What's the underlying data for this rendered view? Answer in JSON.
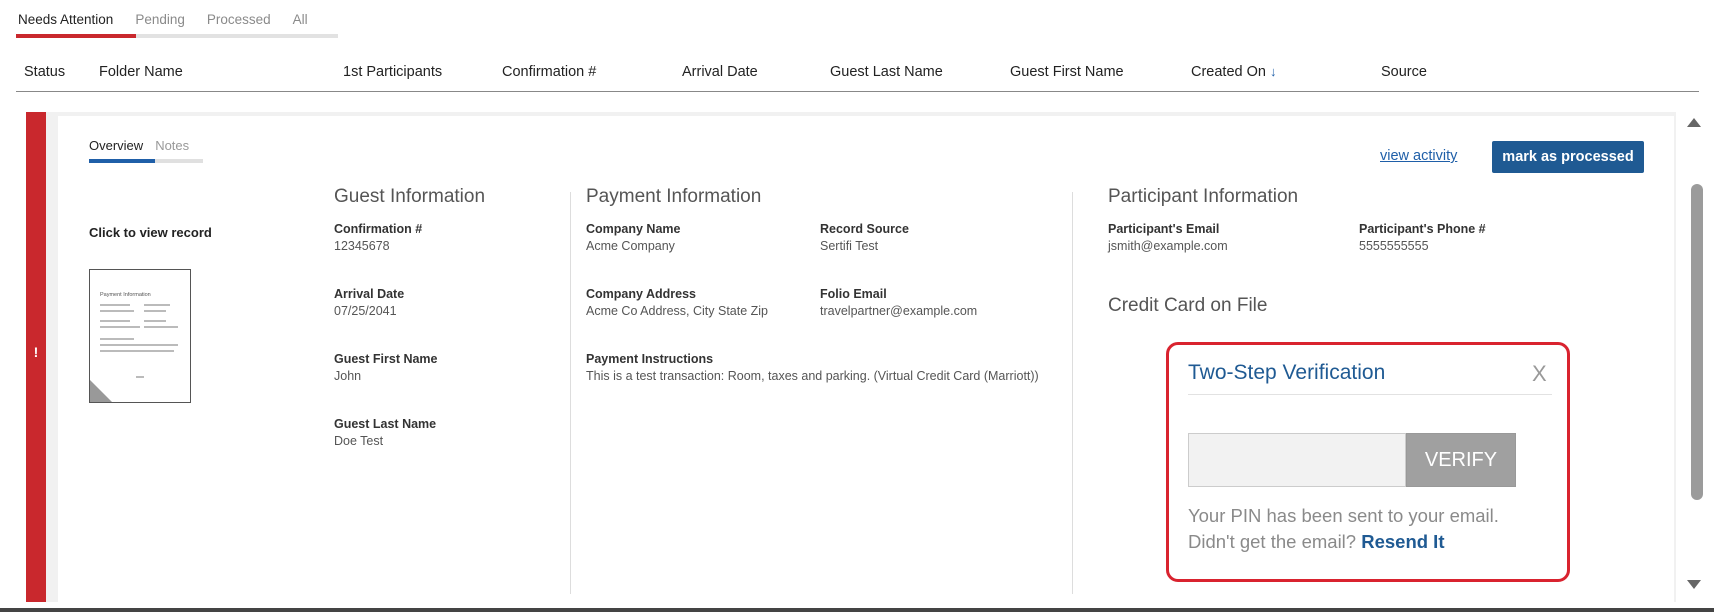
{
  "status_tabs": [
    {
      "label": "Needs Attention"
    },
    {
      "label": "Pending"
    },
    {
      "label": "Processed"
    },
    {
      "label": "All"
    }
  ],
  "columns": {
    "status": "Status",
    "folder_name": "Folder Name",
    "participants": "1st Participants",
    "confirmation": "Confirmation #",
    "arrival_date": "Arrival Date",
    "guest_last_name": "Guest Last Name",
    "guest_first_name": "Guest First Name",
    "created_on": "Created On",
    "source": "Source"
  },
  "row": {
    "status_flag": "!",
    "inner_tabs": [
      {
        "label": "Overview"
      },
      {
        "label": "Notes"
      }
    ],
    "view_activity": "view activity",
    "mark_processed": "mark as processed",
    "record_link": "Click to view record",
    "thumbnail_title": "Payment Information",
    "guest": {
      "title": "Guest Information",
      "confirmation_label": "Confirmation #",
      "confirmation_value": "12345678",
      "arrival_label": "Arrival Date",
      "arrival_value": "07/25/2041",
      "first_label": "Guest First Name",
      "first_value": "John",
      "last_label": "Guest Last Name",
      "last_value": "Doe Test"
    },
    "payment": {
      "title": "Payment Information",
      "company_name_label": "Company Name",
      "company_name_value": "Acme Company",
      "record_source_label": "Record Source",
      "record_source_value": "Sertifi Test",
      "company_address_label": "Company Address",
      "company_address_value": "Acme Co Address, City State Zip",
      "folio_email_label": "Folio Email",
      "folio_email_value": "travelpartner@example.com",
      "instructions_label": "Payment Instructions",
      "instructions_value": "This is a test transaction: Room, taxes and parking. (Virtual Credit Card (Marriott))"
    },
    "participant": {
      "title": "Participant Information",
      "email_label": "Participant's Email",
      "email_value": "jsmith@example.com",
      "phone_label": "Participant's Phone #",
      "phone_value": "5555555555",
      "card_title": "Credit Card on File"
    },
    "verification": {
      "title": "Two-Step Verification",
      "close": "X",
      "verify_button": "VERIFY",
      "pin_message": "Your PIN has been sent to your email.",
      "didnt_get": "Didn't get the email?",
      "resend": "Resend It"
    }
  },
  "colors": {
    "alert_red": "#c9282d",
    "brand_blue": "#1f5a93",
    "highlight_border": "#d9232f"
  },
  "icons": {
    "sort": "arrow-down-icon",
    "close": "close-icon",
    "scroll_up": "triangle-up-icon",
    "scroll_down": "triangle-down-icon"
  }
}
